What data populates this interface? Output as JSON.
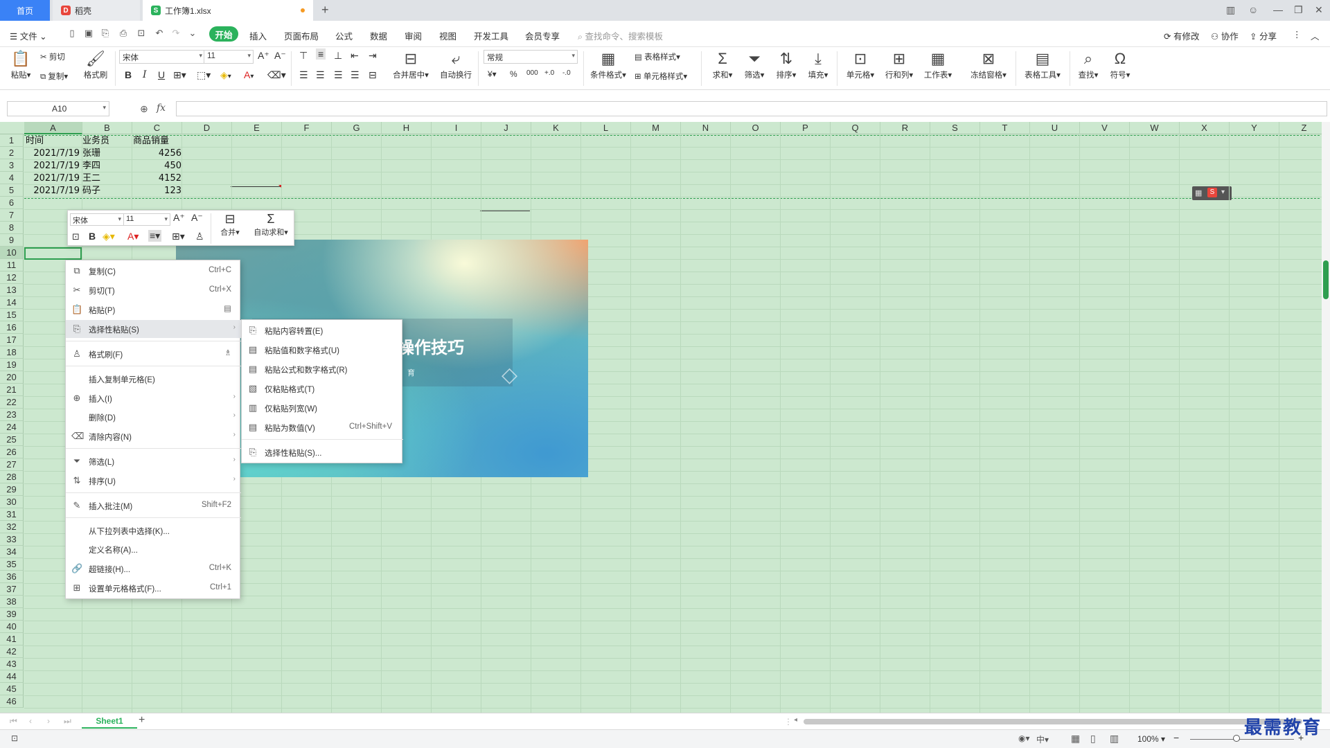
{
  "tabs": {
    "home": "首页",
    "daoke": "稻壳",
    "workbook": "工作簿1.xlsx",
    "add": "+"
  },
  "menubar": {
    "file": "文件",
    "items": [
      "开始",
      "插入",
      "页面布局",
      "公式",
      "数据",
      "审阅",
      "视图",
      "开发工具",
      "会员专享"
    ],
    "search_placeholder": "查找命令、搜索模板",
    "modified": "有修改",
    "collab": "协作",
    "share": "分享"
  },
  "ribbon": {
    "paste": "粘贴",
    "cut": "剪切",
    "copy": "复制",
    "format_painter": "格式刷",
    "font_name": "宋体",
    "font_size": "11",
    "merge_center": "合并居中",
    "wrap": "自动换行",
    "number_format": "常规",
    "cond_format": "条件格式",
    "table_style": "表格样式",
    "cell_style": "单元格样式",
    "sum": "求和",
    "filter": "筛选",
    "sort": "排序",
    "fill": "填充",
    "cells": "单元格",
    "rowcol": "行和列",
    "worksheet": "工作表",
    "freeze": "冻结窗格",
    "table_tools": "表格工具",
    "find": "查找",
    "symbol": "符号"
  },
  "formula_bar": {
    "name_box": "A10",
    "fx": "fx",
    "value": ""
  },
  "columns": [
    "A",
    "B",
    "C",
    "D",
    "E",
    "F",
    "G",
    "H",
    "I",
    "J",
    "K",
    "L",
    "M",
    "N",
    "O",
    "P",
    "Q",
    "R",
    "S",
    "T",
    "U",
    "V",
    "W",
    "X",
    "Y",
    "Z"
  ],
  "rows": [
    "1",
    "2",
    "3",
    "4",
    "5",
    "6",
    "7",
    "8",
    "9",
    "10",
    "11",
    "12",
    "13",
    "14",
    "15",
    "16",
    "17",
    "18",
    "19",
    "20",
    "21",
    "22",
    "23",
    "24",
    "25",
    "26",
    "27",
    "28",
    "29",
    "30",
    "31",
    "32",
    "33",
    "34",
    "35",
    "36",
    "37",
    "38",
    "39",
    "40",
    "41",
    "42",
    "43",
    "44",
    "45",
    "46"
  ],
  "table": {
    "headers": [
      "时间",
      "业务员",
      "商品销量"
    ],
    "rows": [
      [
        "2021/7/19",
        "张珊",
        "4256"
      ],
      [
        "2021/7/19",
        "李四",
        "450"
      ],
      [
        "2021/7/19",
        "王二",
        "4152"
      ],
      [
        "2021/7/19",
        "码子",
        "123"
      ]
    ]
  },
  "picture": {
    "title": "操作技巧",
    "sub": "育"
  },
  "mini_toolbar": {
    "font": "宋体",
    "size": "11",
    "merge": "合并",
    "autosum": "自动求和"
  },
  "context_menu": [
    {
      "label": "复制(C)",
      "shortcut": "Ctrl+C",
      "icon": "copy-icon"
    },
    {
      "label": "剪切(T)",
      "shortcut": "Ctrl+X",
      "icon": "scissors-icon"
    },
    {
      "label": "粘贴(P)",
      "shortcut": "",
      "icon": "paste-icon"
    },
    {
      "label": "选择性粘贴(S)",
      "shortcut": "",
      "icon": "paste-special-icon",
      "submenu": true
    },
    {
      "label": "格式刷(F)",
      "shortcut": "",
      "icon": "format-painter-icon"
    },
    {
      "label": "插入复制单元格(E)",
      "shortcut": "",
      "icon": ""
    },
    {
      "label": "插入(I)",
      "shortcut": "",
      "icon": "insert-icon",
      "submenu": true
    },
    {
      "label": "删除(D)",
      "shortcut": "",
      "icon": "",
      "submenu": true
    },
    {
      "label": "清除内容(N)",
      "shortcut": "",
      "icon": "eraser-icon",
      "submenu": true
    },
    {
      "label": "筛选(L)",
      "shortcut": "",
      "icon": "filter-icon",
      "submenu": true
    },
    {
      "label": "排序(U)",
      "shortcut": "",
      "icon": "sort-icon",
      "submenu": true
    },
    {
      "label": "插入批注(M)",
      "shortcut": "Shift+F2",
      "icon": "comment-icon"
    },
    {
      "label": "从下拉列表中选择(K)...",
      "shortcut": "",
      "icon": ""
    },
    {
      "label": "定义名称(A)...",
      "shortcut": "",
      "icon": ""
    },
    {
      "label": "超链接(H)...",
      "shortcut": "Ctrl+K",
      "icon": "link-icon"
    },
    {
      "label": "设置单元格格式(F)...",
      "shortcut": "Ctrl+1",
      "icon": "format-cells-icon"
    }
  ],
  "submenu": [
    {
      "label": "粘贴内容转置(E)",
      "shortcut": ""
    },
    {
      "label": "粘贴值和数字格式(U)",
      "shortcut": ""
    },
    {
      "label": "粘贴公式和数字格式(R)",
      "shortcut": ""
    },
    {
      "label": "仅粘贴格式(T)",
      "shortcut": ""
    },
    {
      "label": "仅粘贴列宽(W)",
      "shortcut": ""
    },
    {
      "label": "粘贴为数值(V)",
      "shortcut": "Ctrl+Shift+V"
    },
    {
      "label": "选择性粘贴(S)...",
      "shortcut": ""
    }
  ],
  "sheet_tabs": {
    "active": "Sheet1",
    "add": "+"
  },
  "status": {
    "zoom": "100%"
  },
  "watermark": "最需教育",
  "colors": {
    "accent": "#2bb25c",
    "grid_bg": "#cce8cf",
    "tab_blue": "#3a82f6"
  }
}
